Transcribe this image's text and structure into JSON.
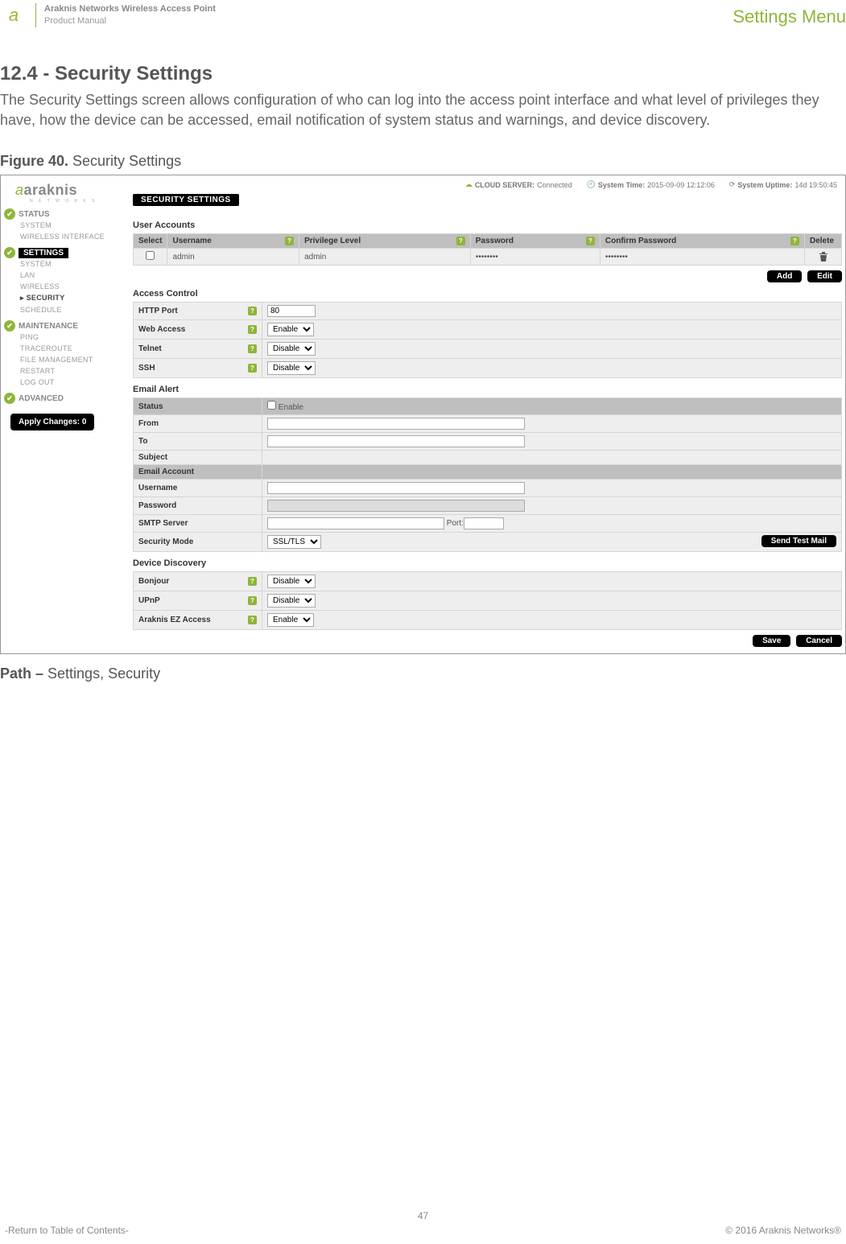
{
  "header": {
    "product_line1": "Araknis Networks Wireless Access Point",
    "product_line2": "Product Manual",
    "right_label": "Settings Menu"
  },
  "section": {
    "heading": "12.4 - Security Settings",
    "intro": "The Security Settings screen allows configuration of who can log into the access point interface and what level of privileges they have, how the device can be accessed, email notification of system status and warnings, and device discovery.",
    "figure_caption_prefix": "Figure 40.",
    "figure_caption_text": " Security Settings",
    "path_prefix": "Path – ",
    "path_text": "Settings, Security"
  },
  "shot": {
    "topbar": {
      "cloud_label": "CLOUD SERVER:",
      "cloud_value": "Connected",
      "systime_label": "System Time:",
      "systime_value": "2015-09-09 12:12:06",
      "uptime_label": "System Uptime:",
      "uptime_value": "14d 19:50:45"
    },
    "pill": "SECURITY SETTINGS",
    "sidebar": {
      "brand": "araknis",
      "brand_sub": "N E T W O R K S",
      "groups": [
        {
          "title": "STATUS",
          "items": [
            "SYSTEM",
            "WIRELESS INTERFACE"
          ],
          "selected": false
        },
        {
          "title": "SETTINGS",
          "items": [
            "SYSTEM",
            "LAN",
            "WIRELESS",
            "▸ SECURITY",
            "SCHEDULE"
          ],
          "selected": true,
          "active_index": 3
        },
        {
          "title": "MAINTENANCE",
          "items": [
            "PING",
            "TRACEROUTE",
            "FILE MANAGEMENT",
            "RESTART",
            "LOG OUT"
          ],
          "selected": false
        },
        {
          "title": "ADVANCED",
          "items": [],
          "selected": false
        }
      ],
      "apply_btn": "Apply Changes: 0"
    },
    "user_accounts": {
      "title": "User Accounts",
      "cols": [
        "Select",
        "Username",
        "Privilege Level",
        "Password",
        "Confirm Password",
        "Delete"
      ],
      "row": {
        "username": "admin",
        "privilege": "admin",
        "password": "••••••••",
        "confirm": "••••••••"
      },
      "btn_add": "Add",
      "btn_edit": "Edit"
    },
    "access_control": {
      "title": "Access Control",
      "rows": [
        {
          "label": "HTTP Port",
          "type": "text",
          "value": "80"
        },
        {
          "label": "Web Access",
          "type": "select",
          "value": "Enable"
        },
        {
          "label": "Telnet",
          "type": "select",
          "value": "Disable"
        },
        {
          "label": "SSH",
          "type": "select",
          "value": "Disable"
        }
      ]
    },
    "email_alert": {
      "title": "Email Alert",
      "rows": [
        {
          "label": "Status",
          "type": "checkbox",
          "cb_label": "Enable"
        },
        {
          "label": "From",
          "type": "wide"
        },
        {
          "label": "To",
          "type": "wide"
        },
        {
          "label": "Subject",
          "type": "none"
        },
        {
          "label": "Email Account",
          "type": "headerstrip"
        },
        {
          "label": "Username",
          "type": "wide"
        },
        {
          "label": "Password",
          "type": "wide_shaded"
        },
        {
          "label": "SMTP Server",
          "type": "port",
          "port_label": "Port:"
        },
        {
          "label": "Security Mode",
          "type": "select",
          "value": "SSL/TLS",
          "trailing_btn": "Send Test Mail"
        }
      ]
    },
    "device_discovery": {
      "title": "Device Discovery",
      "rows": [
        {
          "label": "Bonjour",
          "value": "Disable"
        },
        {
          "label": "UPnP",
          "value": "Disable"
        },
        {
          "label": "Araknis EZ Access",
          "value": "Enable"
        }
      ],
      "btn_save": "Save",
      "btn_cancel": "Cancel"
    }
  },
  "footer": {
    "page": "47",
    "left": "-Return to Table of Contents-",
    "right": "© 2016 Araknis Networks®"
  }
}
